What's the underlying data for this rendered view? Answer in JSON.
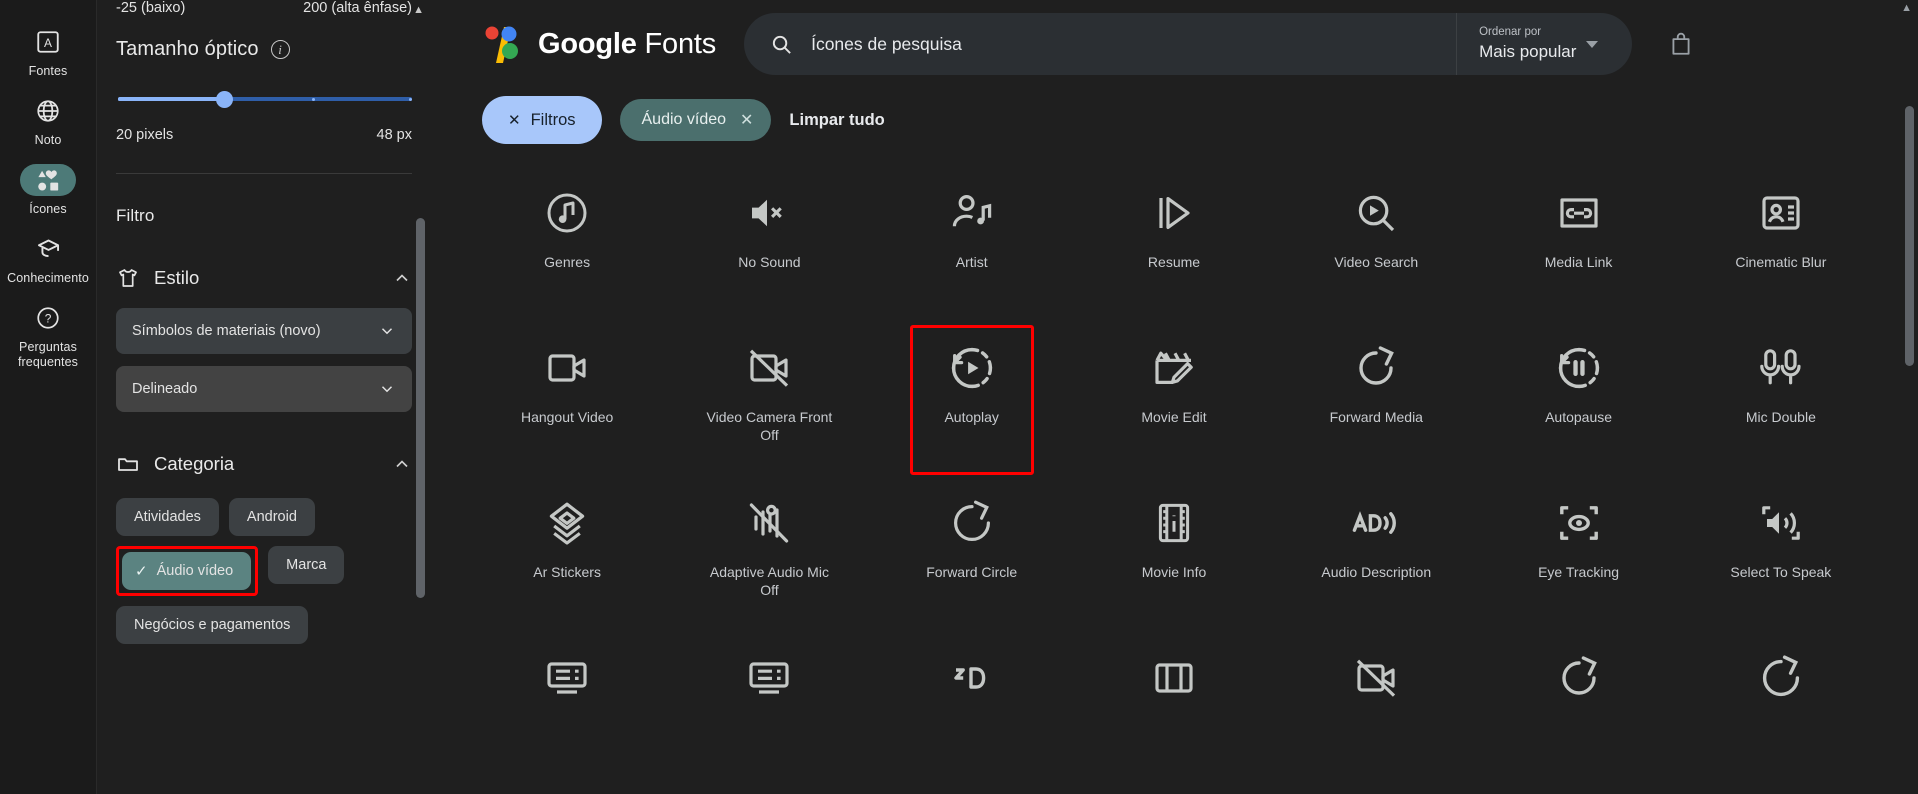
{
  "rail": {
    "items": [
      {
        "label": "Fontes",
        "icon": "font-box-icon",
        "active": false
      },
      {
        "label": "Noto",
        "icon": "globe-icon",
        "active": false
      },
      {
        "label": "Ícones",
        "icon": "shapes-icon",
        "active": true
      },
      {
        "label": "Conhecimento",
        "icon": "graduation-cap-icon",
        "active": false
      },
      {
        "label": "Perguntas\nfrequentes",
        "icon": "help-circle-icon",
        "active": false
      }
    ],
    "faq_line1": "Perguntas",
    "faq_line2": "frequentes"
  },
  "panel": {
    "weight_axis": {
      "min_label": "-25 (baixo)",
      "max_label": "200 (alta ênfase)"
    },
    "optical_size": {
      "title": "Tamanho óptico",
      "info_glyph": "i",
      "value_left": "20 pixels",
      "value_right": "48 px",
      "thumb_percent": 34
    },
    "filter_heading": "Filtro",
    "style_section": {
      "title": "Estilo",
      "icon": "tshirt-icon",
      "expanded_chevron": "chevron-up-icon",
      "selects": [
        {
          "value": "Símbolos de materiais (novo)"
        },
        {
          "value": "Delineado"
        }
      ]
    },
    "category_section": {
      "title": "Categoria",
      "icon": "folder-icon",
      "expanded_chevron": "chevron-up-icon",
      "chips": [
        {
          "label": "Atividades",
          "selected": false,
          "highlighted": false
        },
        {
          "label": "Android",
          "selected": false,
          "highlighted": false
        },
        {
          "label": "Áudio vídeo",
          "selected": true,
          "highlighted": true
        },
        {
          "label": "Marca",
          "selected": false,
          "highlighted": false
        },
        {
          "label": "Negócios e pagamentos",
          "selected": false,
          "highlighted": false
        }
      ]
    }
  },
  "header": {
    "brand_google": "Google",
    "brand_fonts": "Fonts",
    "search_value": "Ícones de pesquisa",
    "search_icon": "search-icon",
    "sort_label": "Ordenar por",
    "sort_value": "Mais popular",
    "bag_icon": "shopping-bag-icon"
  },
  "filters": {
    "filters_pill": "Filtros",
    "active_chip": "Áudio vídeo",
    "clear_all": "Limpar tudo"
  },
  "colors": {
    "accent_blue": "#a8c7fa",
    "chip_teal": "#4b6f6d",
    "highlight_red": "#ff0000",
    "page_bg": "#1f1f1f",
    "rail_bg": "#1b1b1b"
  },
  "grid": {
    "rows": [
      [
        {
          "label": "Genres",
          "icon": "music-note-circle-icon"
        },
        {
          "label": "No Sound",
          "icon": "volume-off-icon"
        },
        {
          "label": "Artist",
          "icon": "person-music-icon"
        },
        {
          "label": "Resume",
          "icon": "play-resume-icon"
        },
        {
          "label": "Video Search",
          "icon": "video-search-icon"
        },
        {
          "label": "Media Link",
          "icon": "media-link-icon"
        },
        {
          "label": "Cinematic Blur",
          "icon": "cinematic-blur-icon"
        }
      ],
      [
        {
          "label": "Hangout Video",
          "icon": "hangout-video-icon"
        },
        {
          "label": "Video Camera Front Off",
          "icon": "video-camera-front-off-icon"
        },
        {
          "label": "Autoplay",
          "icon": "autoplay-icon",
          "highlighted": true
        },
        {
          "label": "Movie Edit",
          "icon": "movie-edit-icon"
        },
        {
          "label": "Forward Media",
          "icon": "forward-media-icon"
        },
        {
          "label": "Autopause",
          "icon": "autopause-icon"
        },
        {
          "label": "Mic Double",
          "icon": "mic-double-icon"
        }
      ],
      [
        {
          "label": "Ar Stickers",
          "icon": "ar-stickers-icon"
        },
        {
          "label": "Adaptive Audio Mic Off",
          "icon": "adaptive-audio-mic-off-icon"
        },
        {
          "label": "Forward Circle",
          "icon": "forward-circle-icon"
        },
        {
          "label": "Movie Info",
          "icon": "movie-info-icon"
        },
        {
          "label": "Audio Description",
          "icon": "audio-description-icon"
        },
        {
          "label": "Eye Tracking",
          "icon": "eye-tracking-icon"
        },
        {
          "label": "Select To Speak",
          "icon": "select-to-speak-icon"
        }
      ],
      [
        {
          "label": "",
          "icon": "dvr-icon"
        },
        {
          "label": "",
          "icon": "dvr-alt-icon"
        },
        {
          "label": "",
          "icon": "three-d-icon"
        },
        {
          "label": "",
          "icon": "frame-icon"
        },
        {
          "label": "",
          "icon": "video-off-icon"
        },
        {
          "label": "",
          "icon": "refresh-icon"
        },
        {
          "label": "",
          "icon": "circle-icon"
        }
      ]
    ]
  }
}
